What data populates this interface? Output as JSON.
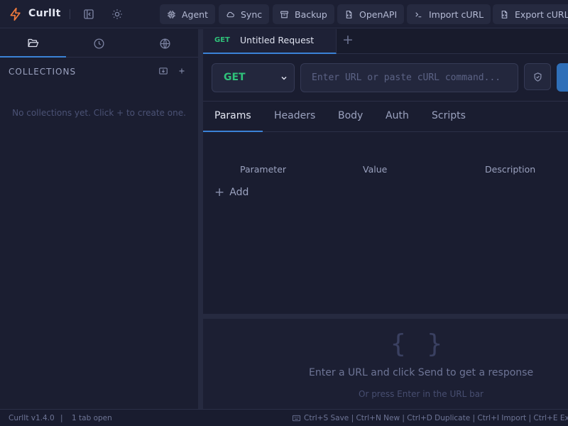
{
  "app": {
    "name": "CurlIt"
  },
  "toolbar": {
    "agent": "Agent",
    "sync": "Sync",
    "backup": "Backup",
    "openapi": "OpenAPI",
    "import_curl": "Import cURL",
    "export_curl": "Export cURL"
  },
  "sidebar": {
    "tabs": [
      "collections",
      "history",
      "environments"
    ],
    "collections_header": "COLLECTIONS",
    "empty_message": "No collections yet. Click + to create one."
  },
  "request_tab": {
    "method": "GET",
    "title": "Untitled Request"
  },
  "url_bar": {
    "method": "GET",
    "placeholder": "Enter URL or paste cURL command..."
  },
  "section_tabs": [
    "Params",
    "Headers",
    "Body",
    "Auth",
    "Scripts"
  ],
  "params": {
    "columns": [
      "Parameter",
      "Value",
      "Description"
    ],
    "add_label": "Add"
  },
  "response": {
    "placeholder_glyph": "{ }",
    "message": "Enter a URL and click Send to get a response",
    "hint": "Or press Enter in the URL bar"
  },
  "status_bar": {
    "version": "CurlIt v1.4.0",
    "separator": "|",
    "tabs_open": "1 tab open",
    "shortcuts": "Ctrl+S Save | Ctrl+N New | Ctrl+D Duplicate | Ctrl+I Import | Ctrl+E Export"
  },
  "colors": {
    "accent": "#3b82d6",
    "method_get": "#2fc27a",
    "logo": "#f07a3c"
  }
}
